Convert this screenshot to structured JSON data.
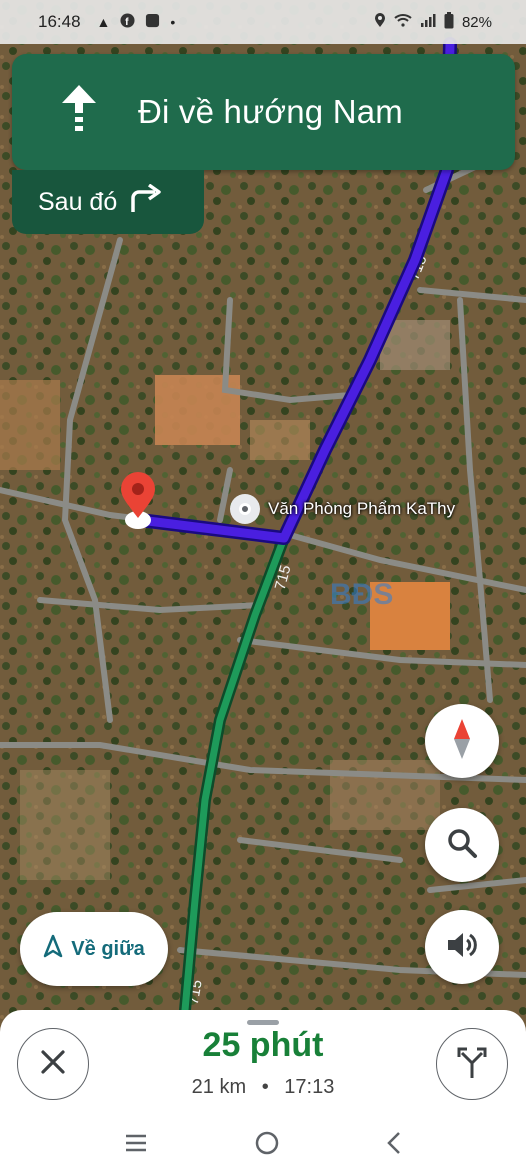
{
  "status_bar": {
    "time": "16:48",
    "battery": "82%",
    "left_icons": [
      "navigation-icon",
      "facebook-icon",
      "app-icon",
      "dot-icon"
    ],
    "right_icons": [
      "location-icon",
      "wifi-icon",
      "signal-icon",
      "battery-icon"
    ]
  },
  "navigation": {
    "instruction": "Đi về hướng Nam",
    "direction_icon": "arrow-up-icon",
    "then_label": "Sau đó",
    "then_icon": "turn-right-icon"
  },
  "map": {
    "poi_label": "Văn Phòng Phẩm KaThy",
    "road_labels": [
      "715",
      "715",
      "715"
    ],
    "watermark": "BĐS"
  },
  "controls": {
    "compass_icon": "compass-icon",
    "search_icon": "search-icon",
    "sound_icon": "volume-icon",
    "recenter_label": "Về giữa"
  },
  "trip": {
    "duration": "25 phút",
    "distance": "21 km",
    "separator": "•",
    "arrival": "17:13"
  },
  "colors": {
    "nav_green": "#1f6b4c",
    "route_blue": "#4a1fe0",
    "route_green": "#1e9a5a",
    "eta_green": "#188038",
    "pin_red": "#ea4335"
  }
}
